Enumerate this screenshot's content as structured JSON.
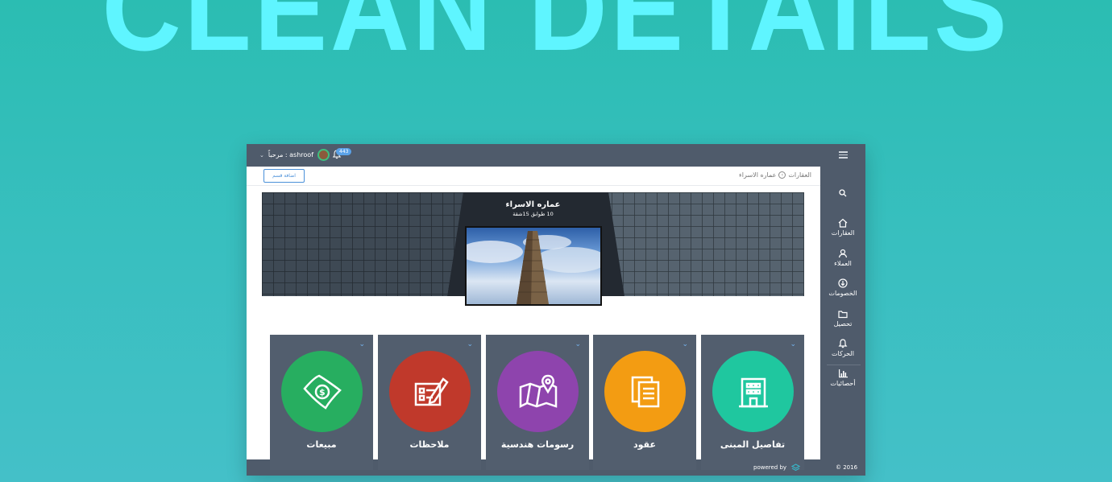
{
  "hero_text": "CLEAN DETAILS",
  "topbar": {
    "greeting": "مرحباً : ashroof",
    "notification_count": "443"
  },
  "content": {
    "add_button": "اضافة قسم",
    "breadcrumb": [
      "العقارات",
      "عماره الاسراء"
    ]
  },
  "banner": {
    "title": "عماره الاسراء",
    "meta": "10 طوابق  15شقة"
  },
  "tiles": [
    {
      "label": "تفاصيل المبنى",
      "color": "#1fc79f",
      "icon": "building-icon"
    },
    {
      "label": "عقود",
      "color": "#f39c12",
      "icon": "documents-icon"
    },
    {
      "label": "رسومات هندسية",
      "color": "#8e44ad",
      "icon": "map-pin-icon"
    },
    {
      "label": "ملاحظات",
      "color": "#c0392b",
      "icon": "note-edit-icon"
    },
    {
      "label": "مبيعات",
      "color": "#27ae60",
      "icon": "money-icon"
    }
  ],
  "sidebar": {
    "items": [
      {
        "label": "العقارات",
        "icon": "home-icon"
      },
      {
        "label": "العملاء",
        "icon": "users-icon"
      },
      {
        "label": "الخصومات",
        "icon": "discount-icon"
      },
      {
        "label": "تحصيل",
        "icon": "folder-icon"
      },
      {
        "label": "الحركات",
        "icon": "bell-icon"
      },
      {
        "label": "أحصائيات",
        "icon": "chart-icon"
      }
    ]
  },
  "footer": {
    "powered": "powered by",
    "copyright": "© 2016"
  }
}
